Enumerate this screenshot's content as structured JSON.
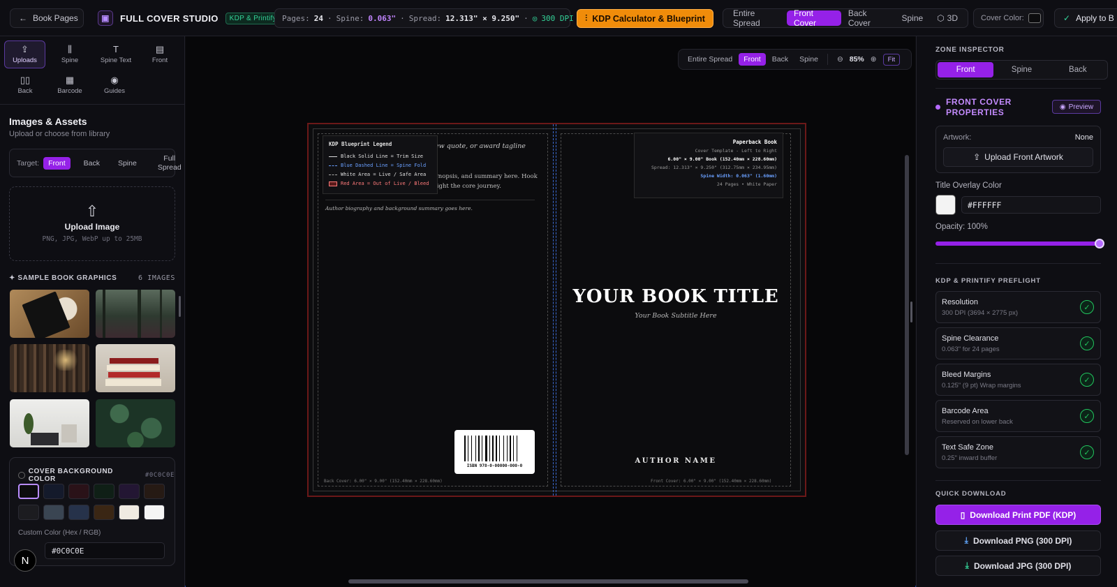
{
  "topbar": {
    "back_label": "Book Pages",
    "app_title": "FULL COVER STUDIO",
    "badge": "KDP & Printify",
    "pages_label": "Pages:",
    "pages_value": "24",
    "spine_label": "Spine:",
    "spine_value": "0.063\"",
    "spread_label": "Spread:",
    "spread_value": "12.313\" × 9.250\"",
    "dpi": "300 DPI",
    "kdp_button": "KDP Calculator & Blueprint",
    "view_tabs": [
      "Entire Spread",
      "Front Cover",
      "Back Cover",
      "Spine",
      "3D"
    ],
    "active_view": "Front Cover",
    "cover_color_label": "Cover Color:",
    "apply_label": "Apply to B"
  },
  "left": {
    "tools": [
      "Uploads",
      "Spine",
      "Spine Text",
      "Front",
      "Back",
      "Barcode",
      "Guides"
    ],
    "section_title": "Images & Assets",
    "section_sub": "Upload or choose from library",
    "target_label": "Target:",
    "targets": [
      "Front",
      "Back",
      "Spine",
      "Full Spread"
    ],
    "upload_title": "Upload Image",
    "upload_sub": "PNG, JPG, WebP up to 25MB",
    "samples_title": "SAMPLE BOOK GRAPHICS",
    "samples_count": "6 IMAGES",
    "bg_title": "COVER BACKGROUND COLOR",
    "bg_hex": "#0C0C0E",
    "custom_label": "Custom Color (Hex / RGB)",
    "custom_value": "#0C0C0E",
    "n_badge": "N",
    "swatches": [
      "#0c0c0e",
      "#141a2b",
      "#2a1218",
      "#0f1f16",
      "#231633",
      "#261a14",
      "#1c1c20",
      "#3a4552",
      "#26324a",
      "#3a2614",
      "#efeae2",
      "#f4f4f4"
    ]
  },
  "canvas": {
    "controls": [
      "Entire Spread",
      "Front",
      "Back",
      "Spine"
    ],
    "active_control": "Front",
    "zoom": "85%",
    "fit": "Fit",
    "legend_title": "KDP Blueprint Legend",
    "legend": [
      "Black Solid Line = Trim Size",
      "Blue Dashed Line = Spine Fold",
      "White Area = Live / Safe Area",
      "Red Area = Out of Live / Bleed"
    ],
    "back_quote": "ew quote, or award tagline",
    "back_blurb": "ynopsis, and summary here. Hook light the core journey.",
    "author_bio": "Author biography and background summary goes here.",
    "isbn": "ISBN 978-0-00000-000-0",
    "back_footer": "Back Cover: 6.00\" × 9.00\" (152.40mm × 228.60mm)",
    "front_footer": "Front Cover: 6.00\" × 9.00\" (152.40mm × 228.60mm)",
    "info": {
      "title": "Paperback Book",
      "line1": "Cover Template - Left to Right",
      "line2": "6.00\" × 9.00\" Book (152.40mm × 228.60mm)",
      "line3": "Spread: 12.313\" × 9.250\" (312.75mm × 234.95mm)",
      "line4": "Spine Width: 0.063\" (1.60mm)",
      "line5": "24 Pages • White Paper"
    },
    "title": "YOUR BOOK TITLE",
    "subtitle": "Your Book Subtitle Here",
    "author": "AUTHOR NAME"
  },
  "right": {
    "header": "ZONE INSPECTOR",
    "zones": [
      "Front",
      "Spine",
      "Back"
    ],
    "active_zone": "Front",
    "props_title": "FRONT COVER PROPERTIES",
    "preview": "Preview",
    "artwork_label": "Artwork:",
    "artwork_value": "None",
    "upload_art": "Upload Front Artwork",
    "overlay_label": "Title Overlay Color",
    "overlay_value": "#FFFFFF",
    "opacity_label": "Opacity: 100%",
    "opacity_fraction": 1.0,
    "preflight_title": "KDP & PRINTIFY PREFLIGHT",
    "checks": [
      {
        "title": "Resolution",
        "sub": "300 DPI (3694 × 2775 px)"
      },
      {
        "title": "Spine Clearance",
        "sub": "0.063\" for 24 pages"
      },
      {
        "title": "Bleed Margins",
        "sub": "0.125\" (9 pt) Wrap margins"
      },
      {
        "title": "Barcode Area",
        "sub": "Reserved on lower back"
      },
      {
        "title": "Text Safe Zone",
        "sub": "0.25\" inward buffer"
      }
    ],
    "quick_title": "QUICK DOWNLOAD",
    "downloads": [
      "Download Print PDF (KDP)",
      "Download PNG (300 DPI)",
      "Download JPG (300 DPI)"
    ]
  }
}
